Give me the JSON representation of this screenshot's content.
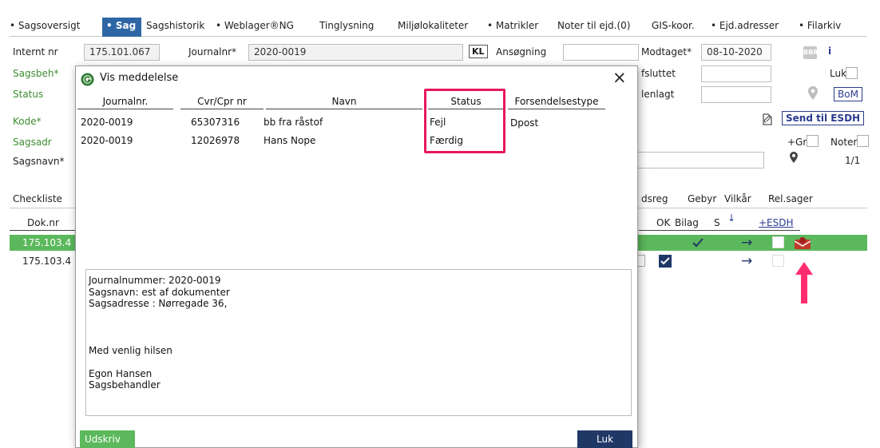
{
  "tabs": [
    {
      "label": "• Sagsoversigt",
      "active": false
    },
    {
      "label": "• Sag",
      "active": true
    },
    {
      "label": "Sagshistorik",
      "active": false
    },
    {
      "label": "• Weblager®NG",
      "active": false
    },
    {
      "label": "Tinglysning",
      "active": false
    },
    {
      "label": "Miljølokaliteter",
      "active": false
    },
    {
      "label": "• Matrikler",
      "active": false
    },
    {
      "label": "Noter til ejd.(0)",
      "active": false
    },
    {
      "label": "GIS-koor.",
      "active": false
    },
    {
      "label": "• Ejd.adresser",
      "active": false
    },
    {
      "label": "• Filarkiv",
      "active": false
    }
  ],
  "form": {
    "internt_nr_label": "Internt nr",
    "internt_nr_value": "175.101.067",
    "journalnr_label": "Journalnr*",
    "journalnr_value": "2020-0019",
    "kl_badge": "KL",
    "ansoegning_label": "Ansøgning",
    "modtaget_label": "Modtaget*",
    "modtaget_value": "08-10-2020",
    "bbr_icon_text": "BBR",
    "info_label": "i",
    "sagsbeh_label": "Sagsbeh*",
    "afsluttet_label": "fsluttet",
    "luk_label": "Luk",
    "status_label": "Status",
    "henlagt_label": "lenlagt",
    "bom_label": "BoM",
    "kode_label": "Kode*",
    "send_esdh_label": "Send til ESDH",
    "sagsadr_label": "Sagsadr",
    "gr_label": "+Gr",
    "noter_label": "Noter",
    "sagsnavn_label": "Sagsnavn*",
    "page_count": "1/1"
  },
  "lower_tabs": {
    "checkliste": "Checkliste",
    "items": [
      "dsreg",
      "Gebyr",
      "Vilkår",
      "Rel.sager"
    ]
  },
  "doc_table": {
    "dok_nr_header": "Dok.nr",
    "headers": [
      "OK",
      "Bilag",
      "S",
      "↓",
      "+ESDH"
    ],
    "rows": [
      {
        "dok_nr": "175.103.4"
      },
      {
        "dok_nr": "175.103.4"
      }
    ]
  },
  "dialog": {
    "title": "Vis meddelelse",
    "close": "×",
    "columns": [
      "Journalnr.",
      "Cvr/Cpr nr",
      "Navn",
      "Status",
      "Forsendelsestype"
    ],
    "rows": [
      {
        "journalnr": "2020-0019",
        "cvr": "65307316",
        "navn": "bb fra råstof",
        "status": "Fejl",
        "forsendelse": "Dpost"
      },
      {
        "journalnr": "2020-0019",
        "cvr": "12026978",
        "navn": "Hans Nope",
        "status": "Færdig",
        "forsendelse": ""
      }
    ],
    "message_lines": [
      "Journalnummer: 2020-0019",
      "Sagsnavn: est af dokumenter",
      "Sagsadresse : Nørregade 36,",
      "",
      "",
      "",
      "Med venlig hilsen",
      "",
      "Egon Hansen",
      "Sagsbehandler"
    ],
    "print_button": "Udskriv",
    "close_button": "Luk"
  },
  "colors": {
    "accent_blue": "#2e66a5",
    "label_green": "#3c8d2f",
    "row_highlight": "#5cb85c",
    "status_highlight": "#e8175d",
    "arrow_pink": "#ff2d6f",
    "print_button_green": "#5cb85c",
    "close_button_navy": "#1f3866"
  }
}
